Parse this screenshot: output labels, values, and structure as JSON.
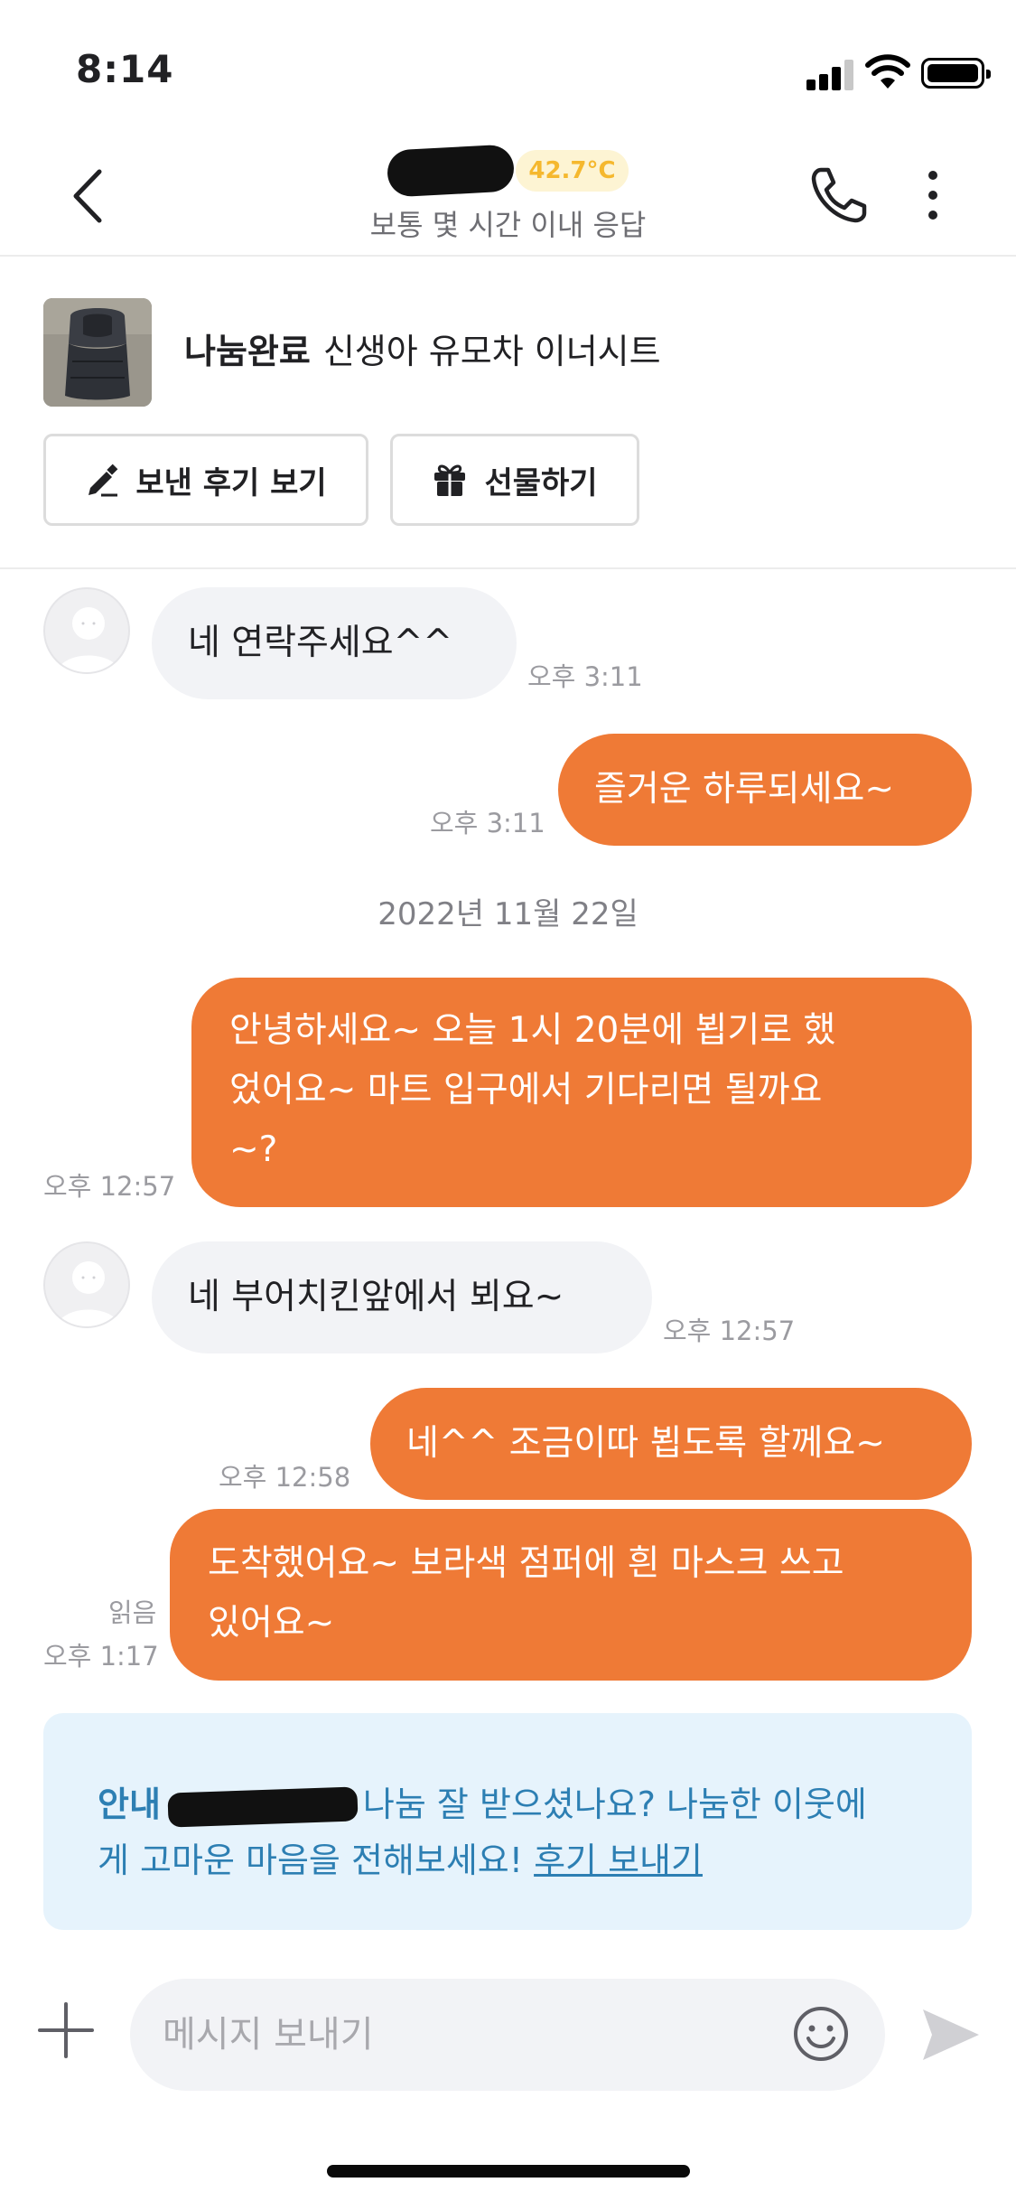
{
  "status_bar": {
    "time": "8:14"
  },
  "header": {
    "temperature": "42.7°C",
    "response_time": "보통 몇 시간 이내 응답"
  },
  "product": {
    "status": "나눔완료",
    "title": "신생아 유모차 이너시트",
    "review_button": "보낸 후기 보기",
    "gift_button": "선물하기"
  },
  "messages": [
    {
      "direction": "in",
      "text": "네 연락주세요^^",
      "time": "오후 3:11"
    },
    {
      "direction": "out",
      "text": "즐거운 하루되세요~",
      "time": "오후 3:11"
    },
    {
      "direction": "out",
      "lines": [
        "안녕하세요~ 오늘 1시 20분에 뵙기로 했",
        "었어요~ 마트 입구에서 기다리면 될까요",
        "~?"
      ],
      "time": "오후 12:57"
    },
    {
      "direction": "in",
      "text": "네 부어치킨앞에서 뵈요~",
      "time": "오후 12:57"
    },
    {
      "direction": "out",
      "text": "네^^ 조금이따 뵙도록 할께요~",
      "time": "오후 12:58"
    },
    {
      "direction": "out",
      "lines": [
        "도착했어요~ 보라색 점퍼에 흰 마스크 쓰고",
        "있어요~"
      ],
      "time": "오후 1:17",
      "read": "읽음"
    }
  ],
  "date_separator": "2022년 11월 22일",
  "notice": {
    "label": "안내",
    "text_line1": "나눔 잘 받으셨나요? 나눔한 이웃에",
    "text_line2": "게 고마운 마음을 전해보세요! ",
    "link": "후기 보내기"
  },
  "input": {
    "placeholder": "메시지 보내기"
  },
  "colors": {
    "accent": "#ef7a36",
    "notice_bg": "#e6f3fc",
    "notice_text": "#2d7fb3",
    "temp_badge": "#f5b82e"
  }
}
